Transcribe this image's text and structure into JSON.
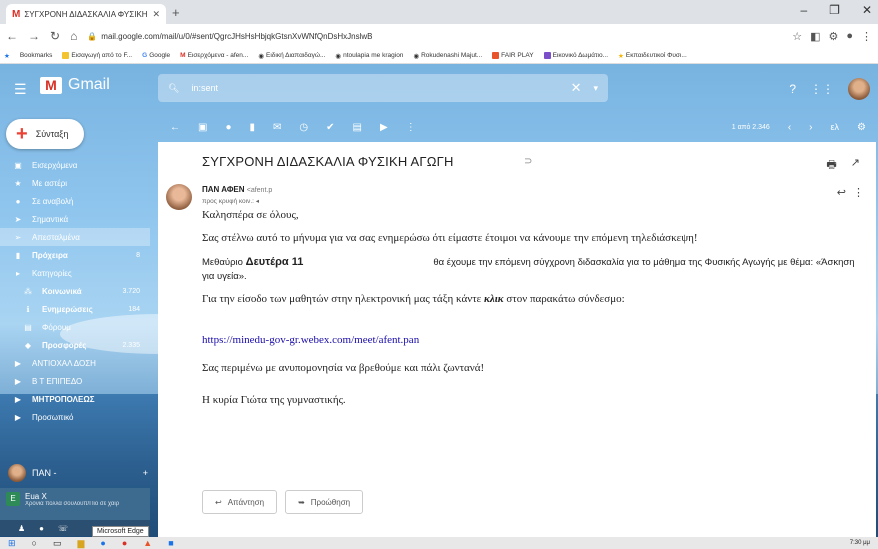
{
  "browser": {
    "tab_title": "ΣΥΓΧΡΟΝΗ ΔΙΔΑΣΚΑΛΙΑ ΦΥΣΙΚΗ",
    "tab_icon": "M",
    "url": "mail.google.com/mail/u/0/#sent/QgrcJHsHsHbjqkGtsnXvWNfQnDsHxJnslwB",
    "bookmarks": [
      "Bookmarks",
      "Εισαγωγή από το F...",
      "Google",
      "Εισερχόμενα - afen...",
      "Ειδική Διαπαιδαγώ...",
      "ntoulapia me kragion",
      "Rokudenashi Majut...",
      "FAIR PLAY",
      "Εικονικό Δωμάτιο...",
      "Εκπαιδευτικοί Φυσι..."
    ]
  },
  "gmail": {
    "logo_text": "Gmail",
    "search_value": "in:sent",
    "compose_label": "Σύνταξη",
    "pagination": "1 από 2.346",
    "lang": "ελ",
    "sidebar": [
      {
        "label": "Εισερχόμενα",
        "icon": "inbox-icon",
        "count": ""
      },
      {
        "label": "Με αστέρι",
        "icon": "star-icon",
        "count": ""
      },
      {
        "label": "Σε αναβολή",
        "icon": "clock-icon",
        "count": ""
      },
      {
        "label": "Σημαντικά",
        "icon": "important-icon",
        "count": ""
      },
      {
        "label": "Απεσταλμένα",
        "icon": "send-icon",
        "count": ""
      },
      {
        "label": "Πρόχειρα",
        "icon": "draft-icon",
        "count": "8"
      },
      {
        "label": "Κατηγορίες",
        "icon": "label-icon",
        "count": ""
      },
      {
        "label": "Κοινωνικά",
        "icon": "people-icon",
        "count": "3.720"
      },
      {
        "label": "Ενημερώσεις",
        "icon": "info-icon",
        "count": "184"
      },
      {
        "label": "Φόρουμ",
        "icon": "forum-icon",
        "count": ""
      },
      {
        "label": "Προσφορές",
        "icon": "tag-icon",
        "count": "2.335"
      },
      {
        "label": "ΑΝΤΙΟΧΑΛ ΔΟΣΗ",
        "icon": "label-icon",
        "count": ""
      },
      {
        "label": "Β Τ ΕΠΙΠΕΔΟ",
        "icon": "label-icon",
        "count": ""
      },
      {
        "label": "ΜΗΤΡΟΠΟΛΕΩΣ",
        "icon": "label-icon",
        "count": ""
      },
      {
        "label": "Προσωπικό",
        "icon": "label-icon",
        "count": ""
      }
    ],
    "hangouts_user": "ΠΑΝ -",
    "hangouts_contact": "Eua X",
    "hangouts_status": "Χρονια πολλα σουλουπ/Πιο σε χαιρ",
    "tooltip": "Microsoft Edge"
  },
  "email": {
    "subject": "ΣΥΓΧΡΟΝΗ ΔΙΔΑΣΚΑΛΙΑ ΦΥΣΙΚΗ ΑΓΩΓΗ",
    "from_name": "ΠΑΝ ΑΦΕΝ",
    "from_email": "<afent.p",
    "to": "προς κρυφή κοιν.:",
    "greeting": "Καλησπέρα σε όλους,",
    "p1": "Σας στέλνω αυτό το μήνυμα για να σας ενημερώσω ότι είμαστε έτοιμοι να κάνουμε την επόμενη τηλεδιάσκεψη!",
    "p2a": "Μεθαύριο",
    "p2b": "Δευτέρα 11",
    "p2c": "θα έχουμε την επόμενη σύγχρονη διδασκαλία για το μάθημα της Φυσικής Αγωγής με θέμα: «Άσκηση για υγεία».",
    "p3a": "Για την είσοδο των μαθητών στην ηλεκτρονική μας τάξη κάντε",
    "p3b": "κλικ",
    "p3c": "στον παρακάτω σύνδεσμο:",
    "link": "https://minedu-gov-gr.webex.com/meet/afent.pan",
    "p4": "Σας περιμένω με ανυπομονησία να βρεθούμε και πάλι ζωντανά!",
    "sign": "Η κυρία Γιώτα της γυμναστικής.",
    "reply_label": "Απάντηση",
    "forward_label": "Προώθηση"
  },
  "taskbar": {
    "clock": "7:30 μμ"
  }
}
